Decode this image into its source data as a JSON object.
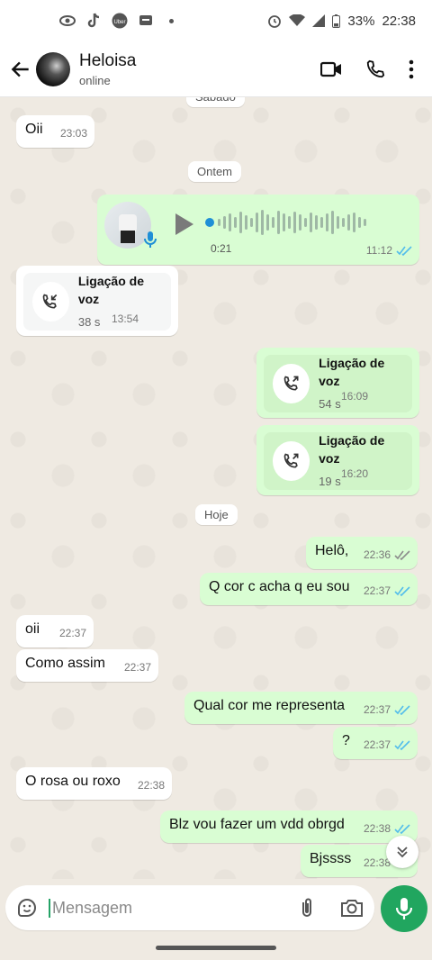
{
  "status_bar": {
    "battery": "33%",
    "time": "22:38"
  },
  "header": {
    "name": "Heloisa",
    "status": "online"
  },
  "dates": {
    "top_partial": "Sábado",
    "yesterday": "Ontem",
    "today": "Hoje"
  },
  "messages": [
    {
      "text": "Oii",
      "time": "23:03"
    },
    {
      "text": "Helô,",
      "time": "22:36"
    },
    {
      "text": "Q cor c acha q eu sou",
      "time": "22:37"
    },
    {
      "text": "oii",
      "time": "22:37"
    },
    {
      "text": "Como assim",
      "time": "22:37"
    },
    {
      "text": "Qual cor me representa",
      "time": "22:37"
    },
    {
      "text": "?",
      "time": "22:37"
    },
    {
      "text": "O rosa ou roxo",
      "time": "22:38"
    },
    {
      "text": "Blz vou fazer um vdd obrgd",
      "time": "22:38"
    },
    {
      "text": "Bjssss",
      "time": "22:38"
    }
  ],
  "voice": {
    "duration": "0:21",
    "time": "11:12"
  },
  "calls": [
    {
      "title": "Ligação de voz",
      "duration": "38 s",
      "time": "13:54"
    },
    {
      "title": "Ligação de voz",
      "duration": "54 s",
      "time": "16:09"
    },
    {
      "title": "Ligação de voz",
      "duration": "19 s",
      "time": "16:20"
    }
  ],
  "input": {
    "placeholder": "Mensagem"
  },
  "colors": {
    "outgoing": "#d9fdd3",
    "incoming": "#ffffff",
    "accent": "#21a65f",
    "read_ticks": "#53bdeb"
  }
}
